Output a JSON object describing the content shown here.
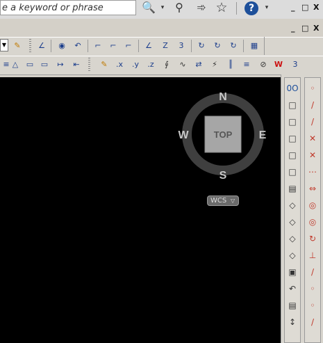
{
  "search": {
    "placeholder": "e a keyword or phrase"
  },
  "top_icons": [
    "binoculars-icon",
    "key-icon",
    "satellite-icon",
    "star-icon",
    "help-icon"
  ],
  "window_controls_1": [
    "_",
    "□",
    "X"
  ],
  "window_controls_2": [
    "_",
    "□",
    "X"
  ],
  "viewcube": {
    "north": "N",
    "south": "S",
    "east": "E",
    "west": "W",
    "face": "TOP",
    "ucs": "WCS"
  },
  "toolbar1_glyphs": [
    "∠",
    "◉",
    "↶",
    "⌐",
    "⌐",
    "⌐",
    "∠",
    "Z",
    "3",
    "↻",
    "↻",
    "↻",
    "▦"
  ],
  "toolbar2_glyphs": [
    "≡",
    "△",
    "▭",
    "▭",
    "↦",
    "✎",
    ".x",
    ".y",
    ".z",
    "⨚",
    "∿",
    "⇄",
    "⚡",
    "║",
    "≡",
    "⊘",
    "W",
    "3"
  ],
  "right_col1": [
    "0O",
    "□",
    "□",
    "□",
    "□",
    "□",
    "▤",
    "◇",
    "◇",
    "◇",
    "◇",
    "▣",
    "↶",
    "▤",
    "↕"
  ],
  "right_col2": [
    "◦",
    "/",
    "/",
    "✕",
    "✕",
    "⋯",
    "⇔",
    "◎",
    "◎",
    "↻",
    "⊥",
    "/",
    "◦",
    "◦",
    "/"
  ]
}
